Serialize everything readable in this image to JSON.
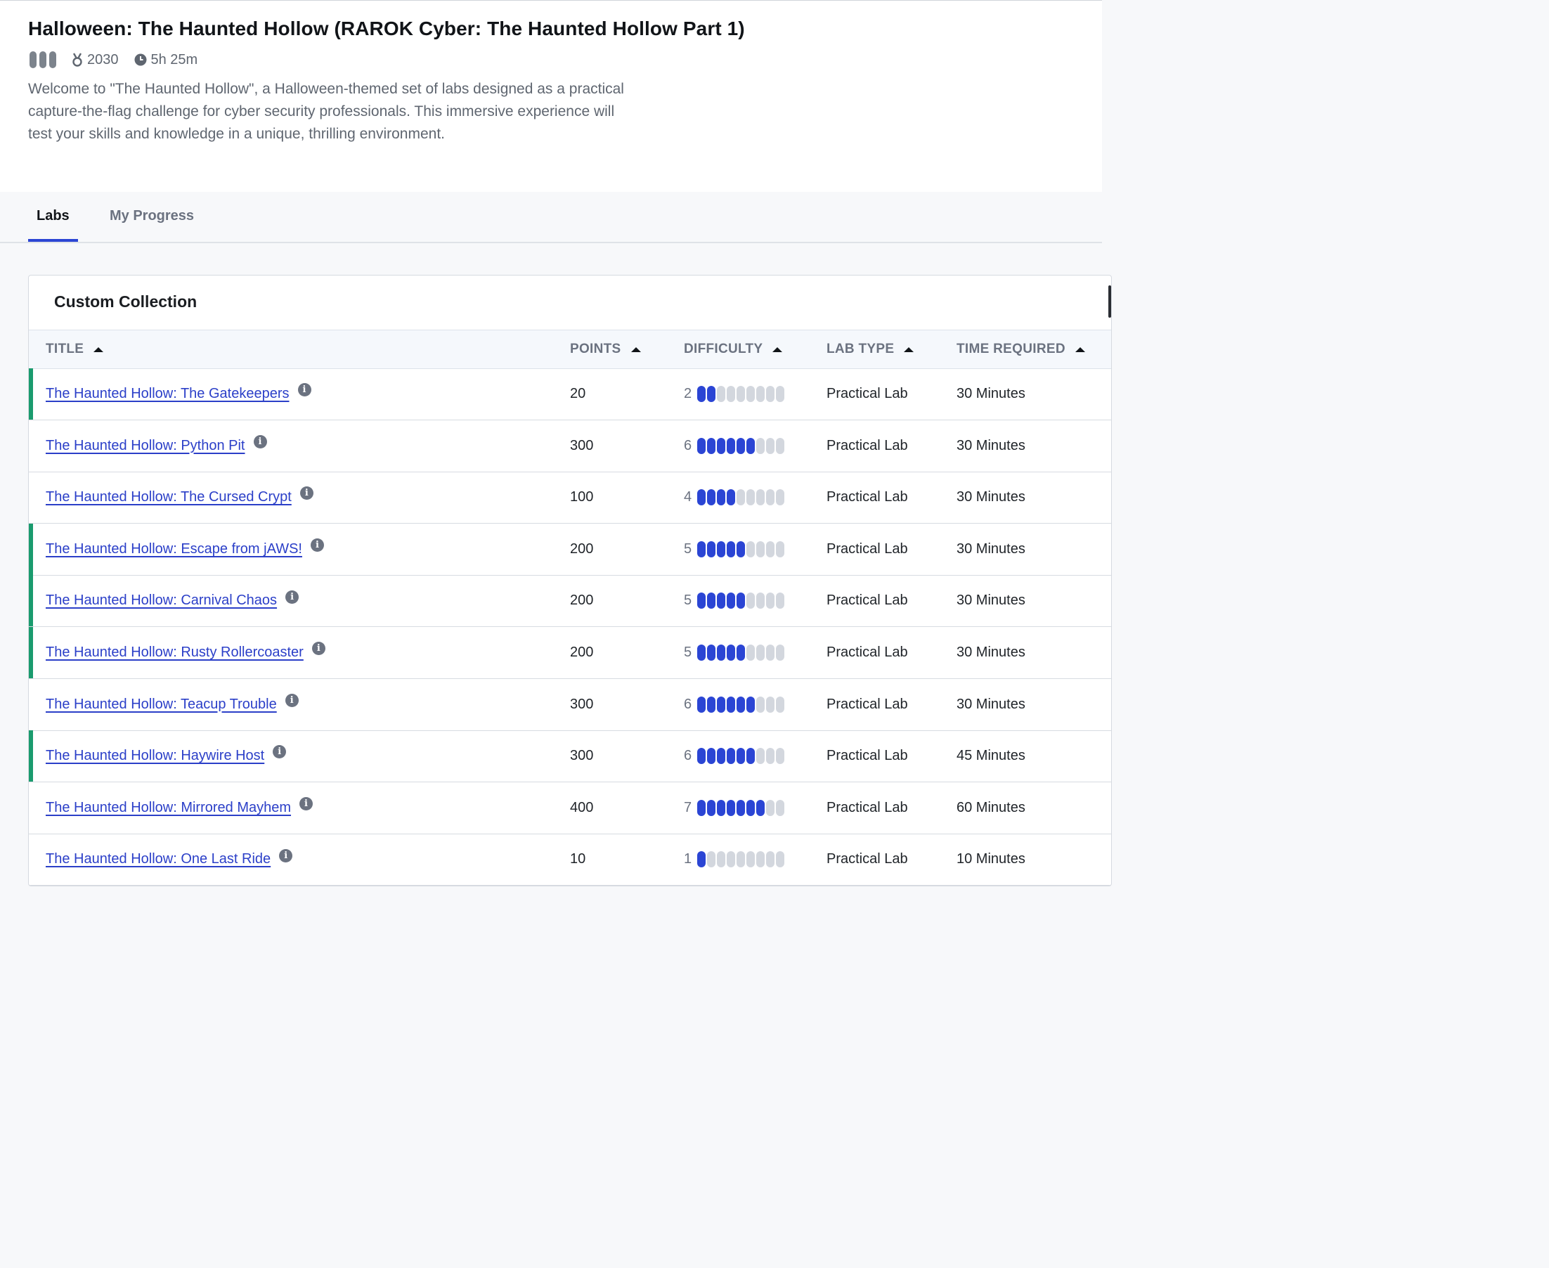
{
  "page": {
    "title": "Halloween: The Haunted Hollow (RAROK Cyber: The Haunted Hollow Part 1)",
    "points": "2030",
    "duration": "5h 25m",
    "description": "Welcome to \"The Haunted Hollow\", a Halloween-themed set of labs designed as a practical capture-the-flag challenge for cyber security professionals. This immersive experience will test your skills and knowledge in a unique, thrilling environment."
  },
  "tabs": [
    {
      "label": "Labs",
      "active": true
    },
    {
      "label": "My Progress",
      "active": false
    }
  ],
  "collection": {
    "title": "Custom Collection",
    "columns": [
      "TITLE",
      "POINTS",
      "DIFFICULTY",
      "LAB TYPE",
      "TIME REQUIRED"
    ],
    "max_difficulty": 9,
    "rows": [
      {
        "title": "The Haunted Hollow: The Gatekeepers",
        "points": "20",
        "difficulty": 2,
        "lab_type": "Practical Lab",
        "time": "30 Minutes",
        "completed": true
      },
      {
        "title": "The Haunted Hollow: Python Pit",
        "points": "300",
        "difficulty": 6,
        "lab_type": "Practical Lab",
        "time": "30 Minutes",
        "completed": false
      },
      {
        "title": "The Haunted Hollow: The Cursed Crypt",
        "points": "100",
        "difficulty": 4,
        "lab_type": "Practical Lab",
        "time": "30 Minutes",
        "completed": false
      },
      {
        "title": "The Haunted Hollow: Escape from jAWS!",
        "points": "200",
        "difficulty": 5,
        "lab_type": "Practical Lab",
        "time": "30 Minutes",
        "completed": true
      },
      {
        "title": "The Haunted Hollow: Carnival Chaos",
        "points": "200",
        "difficulty": 5,
        "lab_type": "Practical Lab",
        "time": "30 Minutes",
        "completed": true
      },
      {
        "title": "The Haunted Hollow: Rusty Rollercoaster",
        "points": "200",
        "difficulty": 5,
        "lab_type": "Practical Lab",
        "time": "30 Minutes",
        "completed": true
      },
      {
        "title": "The Haunted Hollow: Teacup Trouble",
        "points": "300",
        "difficulty": 6,
        "lab_type": "Practical Lab",
        "time": "30 Minutes",
        "completed": false
      },
      {
        "title": "The Haunted Hollow: Haywire Host",
        "points": "300",
        "difficulty": 6,
        "lab_type": "Practical Lab",
        "time": "45 Minutes",
        "completed": true
      },
      {
        "title": "The Haunted Hollow: Mirrored Mayhem",
        "points": "400",
        "difficulty": 7,
        "lab_type": "Practical Lab",
        "time": "60 Minutes",
        "completed": false
      },
      {
        "title": "The Haunted Hollow: One Last Ride",
        "points": "10",
        "difficulty": 1,
        "lab_type": "Practical Lab",
        "time": "10 Minutes",
        "completed": false
      }
    ]
  },
  "icons": {
    "level": "level-bars-icon",
    "points": "medal-icon",
    "duration": "clock-icon",
    "info": "info-icon",
    "sort": "sort-arrow-icon"
  },
  "colors": {
    "accent": "#2b45d4",
    "link": "#2b3fc8",
    "completed_marker": "#1a9b6e"
  }
}
